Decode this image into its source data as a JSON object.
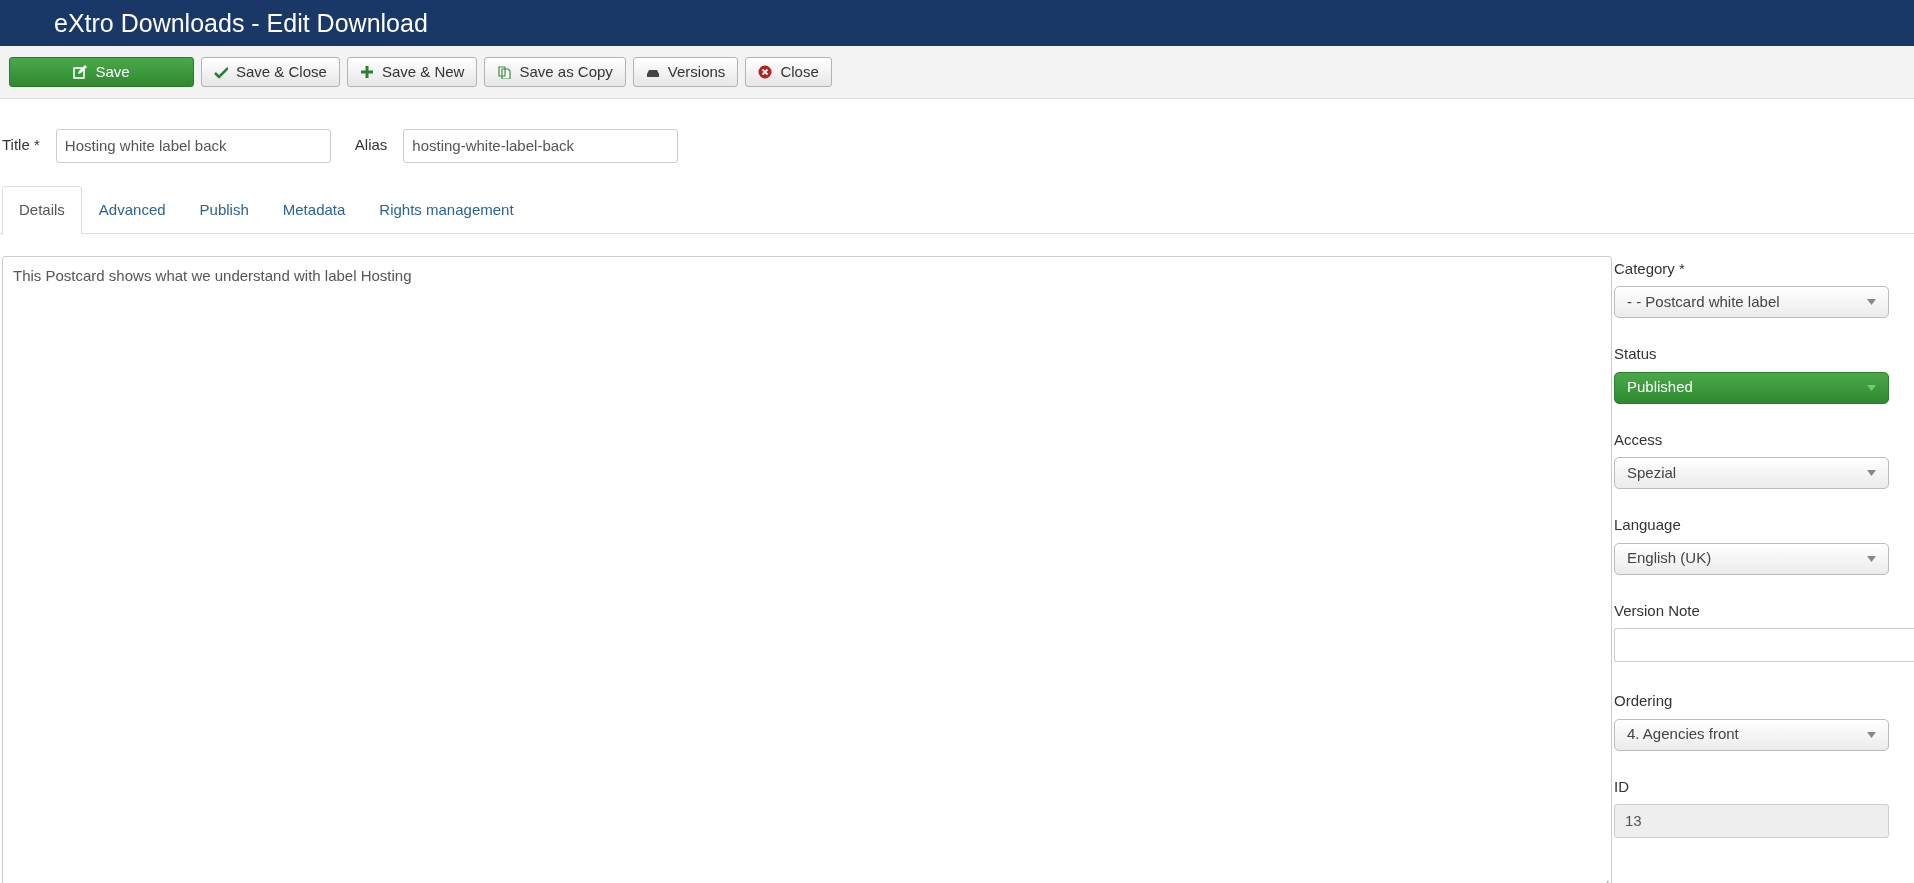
{
  "header": {
    "title": "eXtro Downloads - Edit Download"
  },
  "toolbar": [
    {
      "label": "Save",
      "kind": "primary"
    },
    {
      "label": "Save & Close",
      "kind": "default"
    },
    {
      "label": "Save & New",
      "kind": "default"
    },
    {
      "label": "Save as Copy",
      "kind": "default"
    },
    {
      "label": "Versions",
      "kind": "default"
    },
    {
      "label": "Close",
      "kind": "default"
    }
  ],
  "title_field": {
    "label": "Title *",
    "value": "Hosting white label back"
  },
  "alias_field": {
    "label": "Alias",
    "value": "hosting-white-label-back"
  },
  "tabs": [
    {
      "label": "Details",
      "selected": true
    },
    {
      "label": "Advanced",
      "selected": false
    },
    {
      "label": "Publish",
      "selected": false
    },
    {
      "label": "Metadata",
      "selected": false
    },
    {
      "label": "Rights management",
      "selected": false
    }
  ],
  "editor": {
    "value": "This Postcard shows what we understand with label Hosting"
  },
  "sidebar": [
    {
      "label": "Category *",
      "kind": "select",
      "value": "- - Postcard white label"
    },
    {
      "label": "Status",
      "kind": "status",
      "value": "Published"
    },
    {
      "label": "Access",
      "kind": "select",
      "value": "Spezial"
    },
    {
      "label": "Language",
      "kind": "select",
      "value": "English (UK)"
    },
    {
      "label": "Version Note",
      "kind": "text"
    },
    {
      "label": "Ordering",
      "kind": "select",
      "value": "4. Agencies front"
    },
    {
      "label": "ID",
      "kind": "readonly",
      "value": "13"
    }
  ]
}
